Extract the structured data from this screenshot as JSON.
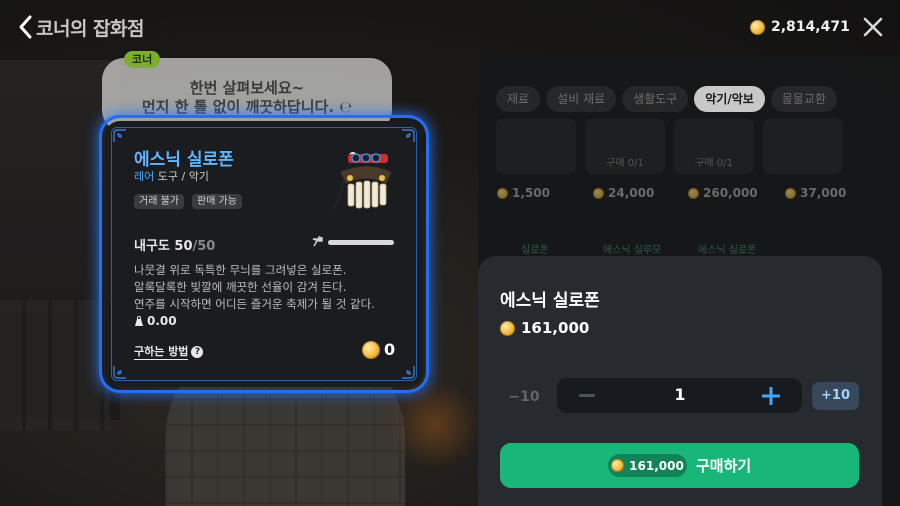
{
  "header": {
    "title": "코너의 잡화점",
    "currency": {
      "amount": "2,814,471",
      "icon": "gold-coin-icon"
    }
  },
  "npc": {
    "name_tag": "코너",
    "line1": "한번 살펴보세요~",
    "line2": "먼지 한 톨 없이 깨끗하답니다. ℮"
  },
  "shop": {
    "tabs": [
      {
        "label": "재료",
        "active": false
      },
      {
        "label": "설비 재료",
        "active": false
      },
      {
        "label": "생활도구",
        "active": false
      },
      {
        "label": "악기/악보",
        "active": true
      },
      {
        "label": "물물교환",
        "active": false
      }
    ],
    "items": [
      {
        "stock": "",
        "price": "1,500",
        "name": "실로폰"
      },
      {
        "stock": "구매 0/1",
        "price": "24,000",
        "name": "에스닉 실루모"
      },
      {
        "stock": "구매 0/1",
        "price": "260,000",
        "name": "에스닉 실로폰"
      },
      {
        "stock": "",
        "price": "37,000",
        "name": ""
      }
    ]
  },
  "item_card": {
    "name": "에스닉 실로폰",
    "rarity": "레어",
    "category": "도구 / 악기",
    "tags": [
      "거래 불가",
      "판매 가능"
    ],
    "durability_label": "내구도",
    "durability_current": "50",
    "durability_max": "/50",
    "durability_fraction": 1.0,
    "description": [
      "나뭇결 위로 독특한 무늬를 그려넣은 실로폰.",
      "알록달록한 빛깔에 깨끗한 선율이 감겨 든다.",
      "연주를 시작하면 어디든 즐거운 축제가 될 것 같다."
    ],
    "weight": "0.00",
    "how_to_get": "구하는 방법",
    "owned_count": "0"
  },
  "purchase": {
    "name": "에스닉 실로폰",
    "price": "161,000",
    "minus10": "−10",
    "quantity": "1",
    "plus10": "+10",
    "total": "161,000",
    "buy_label": "구매하기"
  },
  "colors": {
    "accent_green": "#19b67a",
    "rare_blue": "#4fa8ff",
    "card_glow": "#1e66e8"
  }
}
